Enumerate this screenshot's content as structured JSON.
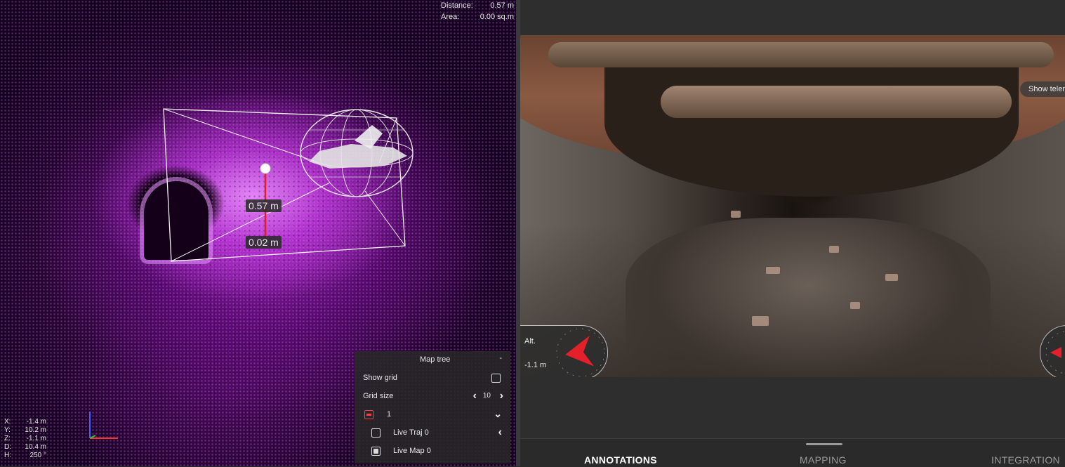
{
  "viewer": {
    "measurements": {
      "distance_label": "Distance:",
      "distance_value": "0.57 m",
      "area_label": "Area:",
      "area_value": "0.00 sq.m"
    },
    "marker_labels": {
      "height": "0.57 m",
      "base": "0.02 m"
    },
    "coordinates": [
      {
        "key": "X:",
        "value": "-1.4 m"
      },
      {
        "key": "Y:",
        "value": "10.2 m"
      },
      {
        "key": "Z:",
        "value": "-1.1 m"
      },
      {
        "key": "D:",
        "value": "10.4 m"
      },
      {
        "key": "H:",
        "value": "250 °"
      }
    ],
    "map_tree": {
      "title": "Map tree",
      "minimize": "-",
      "show_grid_label": "Show grid",
      "show_grid_checked": false,
      "grid_size_label": "Grid size",
      "grid_size_value": "10",
      "layer_name": "1",
      "items": [
        {
          "label": "Live Traj 0",
          "checked": false
        },
        {
          "label": "Live Map 0",
          "checked": true
        }
      ]
    },
    "colors": {
      "point_cloud": "#b03cd8",
      "measure_line": "#e02020",
      "axis_x": "#ff3030",
      "axis_y": "#30c030",
      "axis_z": "#4060ff"
    }
  },
  "video": {
    "show_telemetry": "Show telemetry",
    "altitude": {
      "label": "Alt.",
      "value": "-1.1 m"
    },
    "arrow_color": "#e5202a"
  },
  "bottom_tabs": [
    {
      "label": "ANNOTATIONS",
      "active": true
    },
    {
      "label": "MAPPING",
      "active": false
    },
    {
      "label": "INTEGRATION",
      "active": false
    }
  ]
}
